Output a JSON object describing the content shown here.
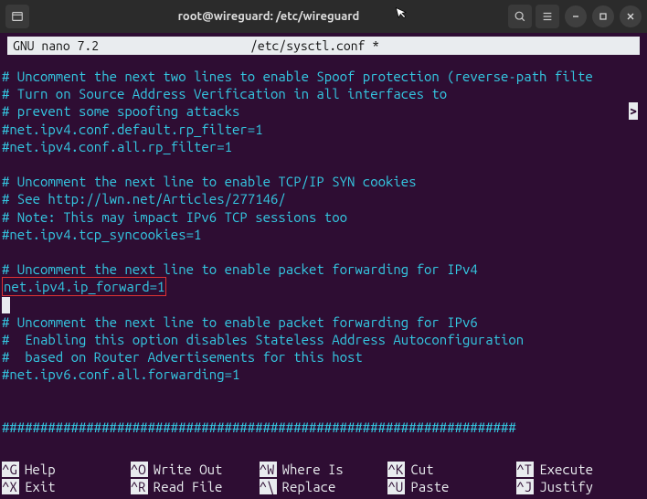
{
  "window": {
    "title": "root@wireguard: /etc/wireguard"
  },
  "nano": {
    "version_label": "GNU nano 7.2",
    "filename": "/etc/sysctl.conf *"
  },
  "content": {
    "lines": [
      "# Uncomment the next two lines to enable Spoof protection (reverse-path filte",
      "# Turn on Source Address Verification in all interfaces to",
      "# prevent some spoofing attacks",
      "#net.ipv4.conf.default.rp_filter=1",
      "#net.ipv4.conf.all.rp_filter=1",
      "",
      "# Uncomment the next line to enable TCP/IP SYN cookies",
      "# See http://lwn.net/Articles/277146/",
      "# Note: This may impact IPv6 TCP sessions too",
      "#net.ipv4.tcp_syncookies=1",
      "",
      "# Uncomment the next line to enable packet forwarding for IPv4",
      "net.ipv4.ip_forward=1",
      "",
      "# Uncomment the next line to enable packet forwarding for IPv6",
      "#  Enabling this option disables Stateless Address Autoconfiguration",
      "#  based on Router Advertisements for this host",
      "#net.ipv6.conf.all.forwarding=1",
      "",
      "",
      "###################################################################"
    ],
    "highlight_index": 12,
    "show_overflow_arrow": true
  },
  "shortcuts": [
    {
      "key": "^G",
      "label": "Help"
    },
    {
      "key": "^O",
      "label": "Write Out"
    },
    {
      "key": "^W",
      "label": "Where Is"
    },
    {
      "key": "^K",
      "label": "Cut"
    },
    {
      "key": "^T",
      "label": "Execute"
    },
    {
      "key": "^X",
      "label": "Exit"
    },
    {
      "key": "^R",
      "label": "Read File"
    },
    {
      "key": "^\\",
      "label": "Replace"
    },
    {
      "key": "^U",
      "label": "Paste"
    },
    {
      "key": "^J",
      "label": "Justify"
    }
  ]
}
